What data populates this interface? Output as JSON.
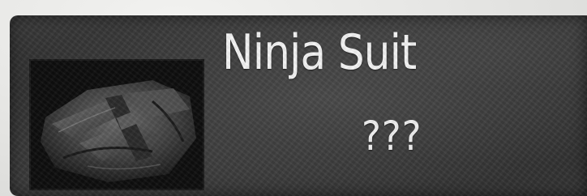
{
  "item": {
    "name": "Ninja Suit",
    "description": "???",
    "icon": "ninja-suit-icon"
  },
  "colors": {
    "card_background": "#2f2f2f",
    "text": "#f4f4f4",
    "page_background": "#e6e6e4"
  }
}
